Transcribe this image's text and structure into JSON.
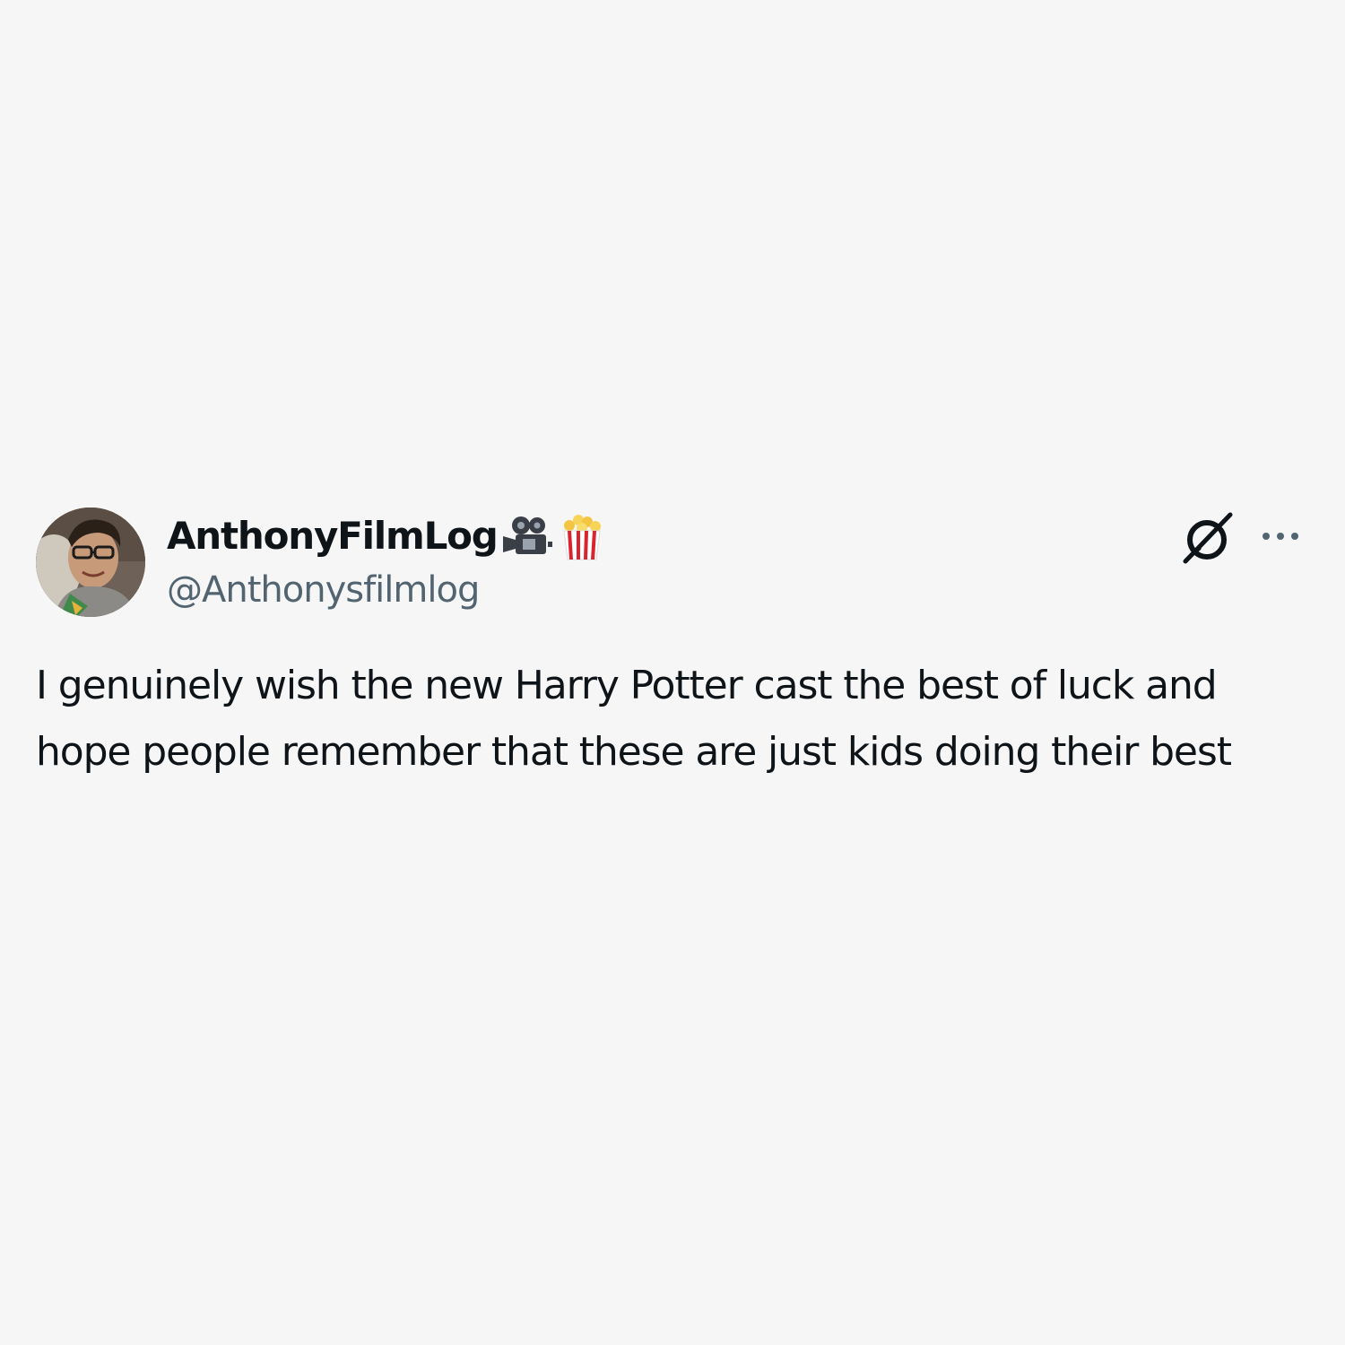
{
  "tweet": {
    "author": {
      "display_name": "AnthonyFilmLog",
      "emojis": [
        "movie-camera-icon",
        "popcorn-icon"
      ],
      "handle": "@Anthonysfilmlog"
    },
    "text": "I genuinely wish the new Harry Potter cast the best of luck and hope people remember that these are just kids doing their best",
    "icons": [
      "grok-icon",
      "more-options-icon"
    ]
  },
  "colors": {
    "background": "#f6f6f6",
    "text_primary": "#0f1419",
    "text_secondary": "#536471"
  }
}
